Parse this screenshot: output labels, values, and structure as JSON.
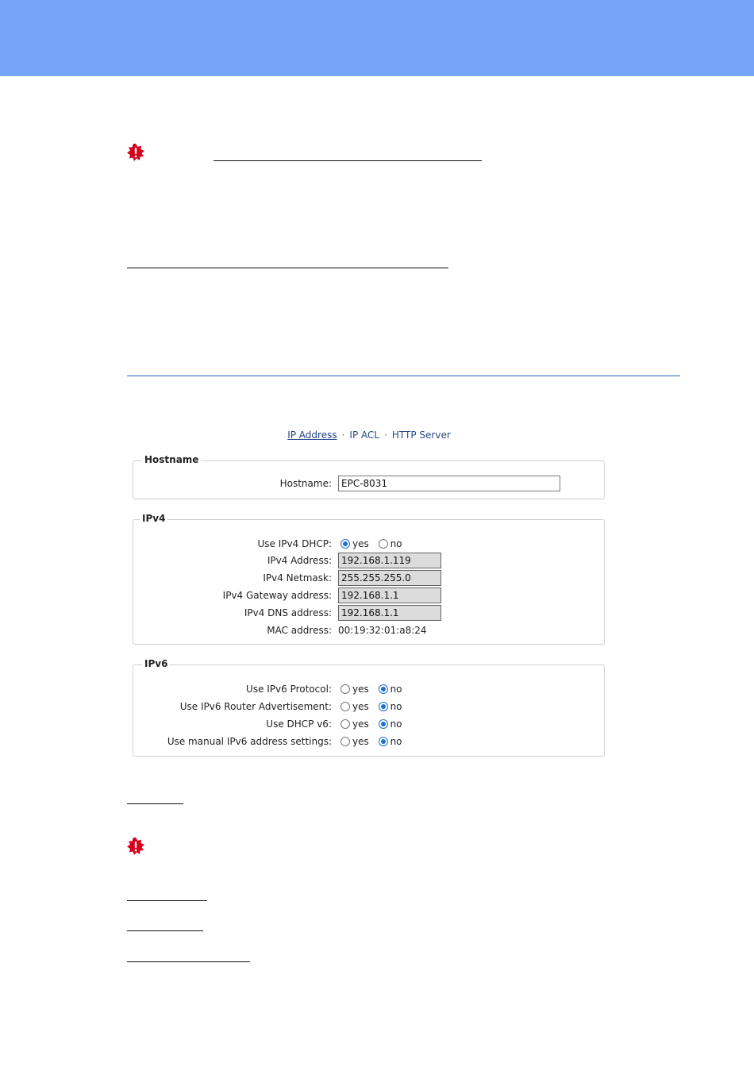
{
  "nav": {
    "items": [
      {
        "label": "IP Address",
        "active": true
      },
      {
        "label": "IP ACL",
        "active": false
      },
      {
        "label": "HTTP Server",
        "active": false
      }
    ],
    "separator": "·"
  },
  "hostname_section": {
    "legend": "Hostname",
    "label": "Hostname:",
    "value": "EPC-8031"
  },
  "ipv4_section": {
    "legend": "IPv4",
    "dhcp": {
      "label": "Use IPv4 DHCP:",
      "yes": "yes",
      "no": "no",
      "selected": "yes"
    },
    "address": {
      "label": "IPv4 Address:",
      "value": "192.168.1.119"
    },
    "netmask": {
      "label": "IPv4 Netmask:",
      "value": "255.255.255.0"
    },
    "gateway": {
      "label": "IPv4 Gateway address:",
      "value": "192.168.1.1"
    },
    "dns": {
      "label": "IPv4 DNS address:",
      "value": "192.168.1.1"
    },
    "mac": {
      "label": "MAC address:",
      "value": "00:19:32:01:a8:24"
    }
  },
  "ipv6_section": {
    "legend": "IPv6",
    "rows": [
      {
        "label": "Use IPv6 Protocol:",
        "yes": "yes",
        "no": "no",
        "selected": "no"
      },
      {
        "label": "Use IPv6 Router Advertisement:",
        "yes": "yes",
        "no": "no",
        "selected": "no"
      },
      {
        "label": "Use DHCP v6:",
        "yes": "yes",
        "no": "no",
        "selected": "no"
      },
      {
        "label": "Use manual IPv6 address settings:",
        "yes": "yes",
        "no": "no",
        "selected": "no"
      }
    ]
  },
  "colors": {
    "header": "#76a4fb",
    "accent": "#1d6fd6",
    "warning": "#d6001c"
  },
  "icons": {
    "warning": "warning-icon"
  }
}
